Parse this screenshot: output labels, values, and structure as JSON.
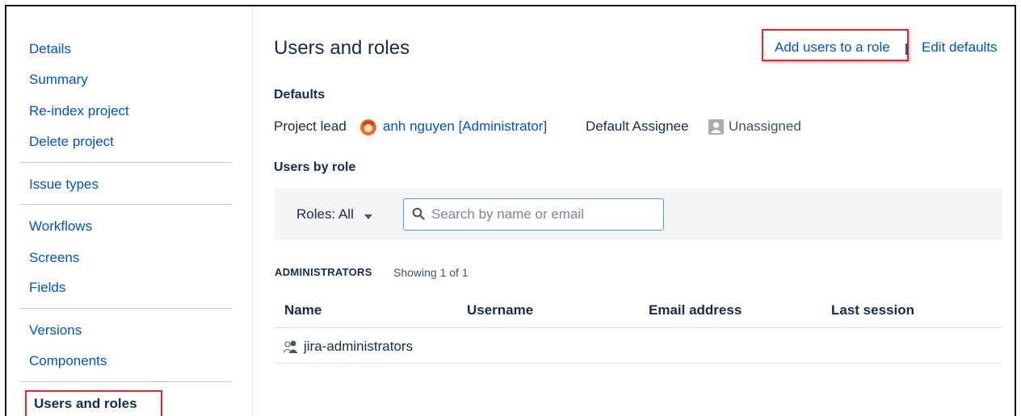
{
  "sidebar": {
    "items": [
      {
        "label": "Details"
      },
      {
        "label": "Summary"
      },
      {
        "label": "Re-index project"
      },
      {
        "label": "Delete project"
      },
      {
        "label": "Issue types"
      },
      {
        "label": "Workflows"
      },
      {
        "label": "Screens"
      },
      {
        "label": "Fields"
      },
      {
        "label": "Versions"
      },
      {
        "label": "Components"
      }
    ],
    "active_label": "Users and roles"
  },
  "header": {
    "title": "Users and roles",
    "add_users_label": "Add users to a role",
    "edit_defaults_label": "Edit defaults"
  },
  "defaults": {
    "heading": "Defaults",
    "project_lead_label": "Project lead",
    "project_lead_value": "anh nguyen [Administrator]",
    "default_assignee_label": "Default Assignee",
    "default_assignee_value": "Unassigned"
  },
  "users_by_role": {
    "heading": "Users by role",
    "roles_filter": "Roles: All",
    "search_placeholder": "Search by name or email",
    "search_value": ""
  },
  "role_section": {
    "name": "ADMINISTRATORS",
    "showing": "Showing 1 of 1",
    "columns": [
      "Name",
      "Username",
      "Email address",
      "Last session"
    ],
    "rows": [
      {
        "name": "jira-administrators",
        "username": "",
        "email": "",
        "last_session": ""
      }
    ]
  },
  "colors": {
    "link": "#0052cc",
    "highlight": "#e0262d",
    "text": "#172b4d"
  }
}
